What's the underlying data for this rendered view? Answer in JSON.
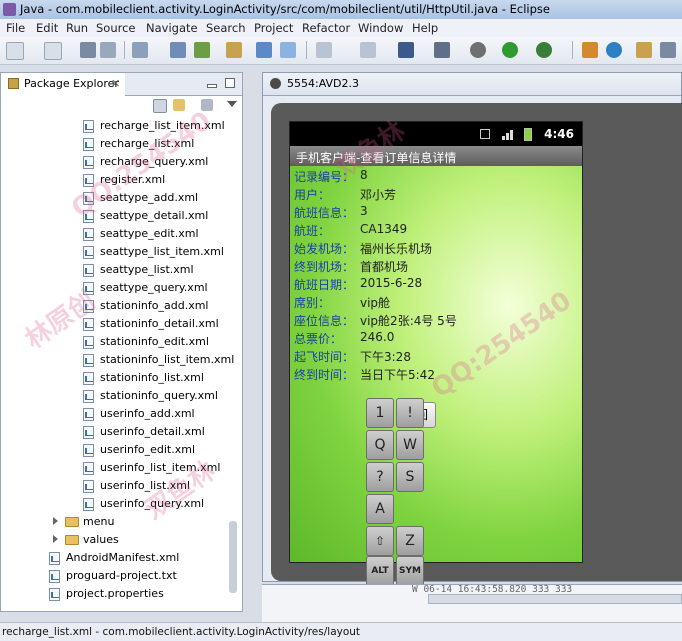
{
  "window": {
    "title": "Java - com.mobileclient.activity.LoginActivity/src/com/mobileclient/util/HttpUtil.java - Eclipse"
  },
  "menu": [
    "File",
    "Edit",
    "Run",
    "Source",
    "Navigate",
    "Search",
    "Project",
    "Refactor",
    "Window",
    "Help"
  ],
  "package_explorer": {
    "tab_label": "Package Explorer",
    "close_glyph": "✕",
    "files": [
      "recharge_list_item.xml",
      "recharge_list.xml",
      "recharge_query.xml",
      "register.xml",
      "seattype_add.xml",
      "seattype_detail.xml",
      "seattype_edit.xml",
      "seattype_list_item.xml",
      "seattype_list.xml",
      "seattype_query.xml",
      "stationinfo_add.xml",
      "stationinfo_detail.xml",
      "stationinfo_edit.xml",
      "stationinfo_list_item.xml",
      "stationinfo_list.xml",
      "stationinfo_query.xml",
      "userinfo_add.xml",
      "userinfo_detail.xml",
      "userinfo_edit.xml",
      "userinfo_list_item.xml",
      "userinfo_list.xml",
      "userinfo_query.xml"
    ],
    "folders": [
      "menu",
      "values"
    ],
    "root_files": [
      "AndroidManifest.xml",
      "proguard-project.txt",
      "project.properties"
    ]
  },
  "emulator": {
    "tab_label": "5554:AVD2.3",
    "status_time": "4:46",
    "app_title": "手机客户端-查看订单信息详情",
    "fields": [
      {
        "label": "记录编号：",
        "value": "8"
      },
      {
        "label": "用户：",
        "value": "邓小芳"
      },
      {
        "label": "航班信息：",
        "value": "3"
      },
      {
        "label": "航班：",
        "value": "CA1349"
      },
      {
        "label": "始发机场：",
        "value": "福州长乐机场"
      },
      {
        "label": "终到机场：",
        "value": "首都机场"
      },
      {
        "label": "航班日期：",
        "value": "2015-6-28"
      },
      {
        "label": "席别：",
        "value": "vip舱"
      },
      {
        "label": "座位信息：",
        "value": "vip舱2张:4号  5号"
      },
      {
        "label": "总票价：",
        "value": "246.0"
      },
      {
        "label": "起飞时间：",
        "value": "下午3:28"
      },
      {
        "label": "终到时间：",
        "value": "当日下午5:42"
      }
    ],
    "back_button": "返回",
    "keys": [
      "1",
      "!",
      "Q",
      "W",
      "?",
      "S",
      "A",
      "Z",
      "ALT",
      "SYM"
    ]
  },
  "log_line": "W   06-14 16:43:58.820   333   333",
  "status_bar": "recharge_list.xml - com.mobileclient.activity.LoginActivity/res/layout",
  "watermarks": [
    "QQ:254540",
    "林原创",
    "双鱼林"
  ]
}
